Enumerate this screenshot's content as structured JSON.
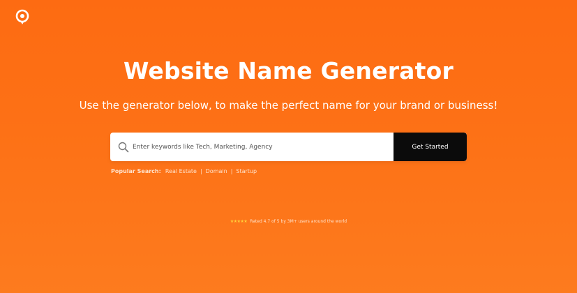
{
  "header": {
    "logo_icon": "location-pin-logo-icon"
  },
  "hero": {
    "title": "Website Name Generator",
    "subtitle": "Use the generator below, to make the perfect name for your brand or business!"
  },
  "search": {
    "icon": "search-icon",
    "placeholder": "Enter keywords like Tech, Marketing, Agency",
    "value": "",
    "button_label": "Get Started"
  },
  "popular": {
    "label": "Popular Search:",
    "items": [
      "Real Estate",
      "Domain",
      "Startup"
    ],
    "separator": "|"
  },
  "rating": {
    "stars": "★★★★★",
    "text": "Rated 4.7 of 5 by 3M+ users around the world"
  },
  "colors": {
    "background": "#fd6f14",
    "button": "#0b0b0b",
    "stars": "#ffd23a"
  }
}
